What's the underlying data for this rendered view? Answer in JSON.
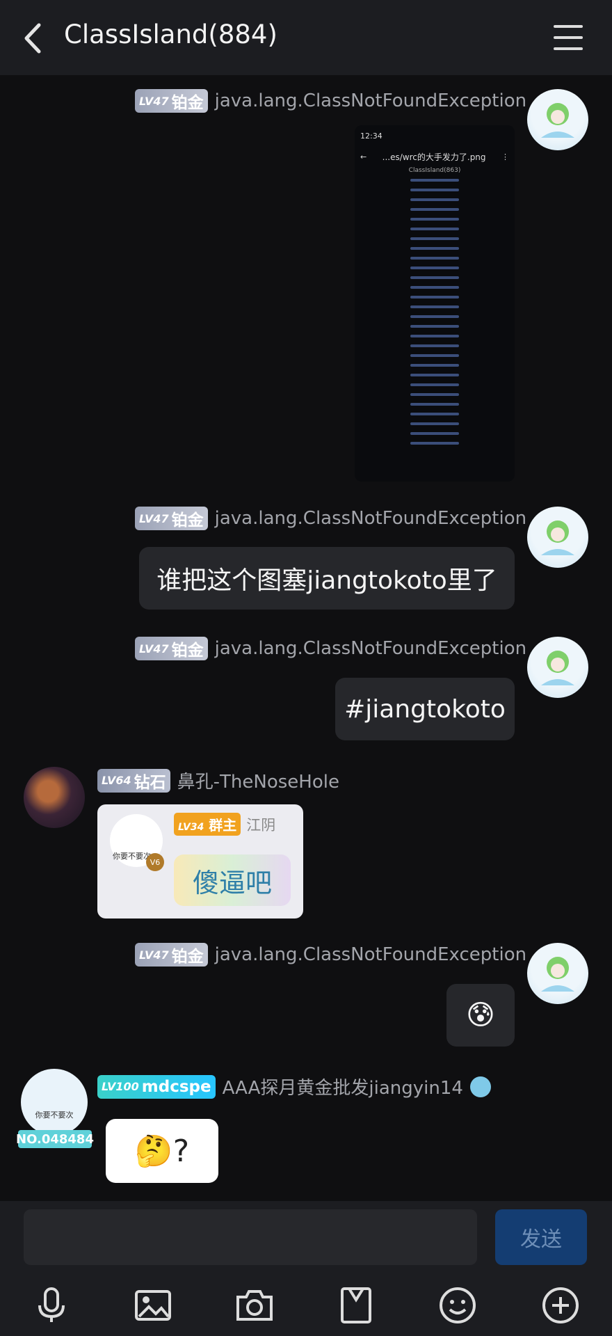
{
  "header": {
    "title": "ClassIsland(884)"
  },
  "messages": [
    {
      "level": "LV47",
      "rank": "铂金",
      "name": "java.lang.ClassNotFoundException",
      "kind": "image",
      "image": {
        "time": "12:34",
        "file_title": "...es/wrc的大手发力了.png",
        "chat_title": "ClassIsland(863)"
      }
    },
    {
      "level": "LV47",
      "rank": "铂金",
      "name": "java.lang.ClassNotFoundException",
      "text": "谁把这个图塞jiangtokoto里了"
    },
    {
      "level": "LV47",
      "rank": "铂金",
      "name": "java.lang.ClassNotFoundException",
      "text": "#jiangtokoto"
    },
    {
      "level": "LV64",
      "rank": "钻石",
      "name": "鼻孔-TheNoseHole",
      "sticker": {
        "level": "LV34",
        "role": "群主",
        "name": "江阴",
        "caption": "你要不要次",
        "badge": "V6",
        "big_text": "傻逼吧"
      }
    },
    {
      "level": "LV47",
      "rank": "铂金",
      "name": "java.lang.ClassNotFoundException",
      "text": "😰"
    },
    {
      "level": "LV100",
      "rank": "mdcspe",
      "name": "AAA探月黄金批发jiangyin14",
      "text": "🤔?",
      "avatar_badge": "NO.048484",
      "avatar_caption": "你要不要次"
    }
  ],
  "input": {
    "value": "",
    "send_label": "发送"
  },
  "toolbar": [
    "mic-icon",
    "image-icon",
    "camera-icon",
    "file-icon",
    "emoji-icon",
    "plus-icon"
  ]
}
